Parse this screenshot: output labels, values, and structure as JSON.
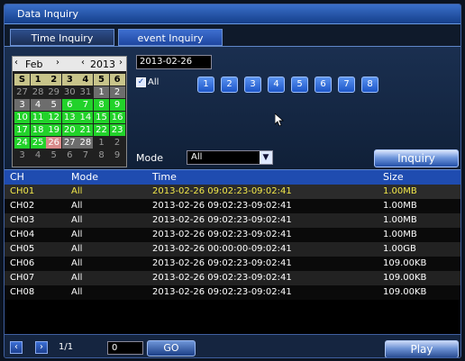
{
  "window": {
    "title": "Data Inquiry"
  },
  "tabs": [
    {
      "label": "Time Inquiry",
      "active": false
    },
    {
      "label": "event Inquiry",
      "active": true
    }
  ],
  "calendar": {
    "prev_month": "‹",
    "month": "Feb",
    "next_month": "›",
    "prev_year": "‹",
    "year": "2013",
    "next_year": "›",
    "weekdays": [
      "S",
      "1",
      "2",
      "3",
      "4",
      "5",
      "6"
    ],
    "weeks": [
      [
        "27",
        "28",
        "29",
        "30",
        "31",
        "1",
        "2"
      ],
      [
        "3",
        "4",
        "5",
        "6",
        "7",
        "8",
        "9"
      ],
      [
        "10",
        "11",
        "12",
        "13",
        "14",
        "15",
        "16"
      ],
      [
        "17",
        "18",
        "19",
        "20",
        "21",
        "22",
        "23"
      ],
      [
        "24",
        "25",
        "26",
        "27",
        "28",
        "1",
        "2"
      ],
      [
        "3",
        "4",
        "5",
        "6",
        "7",
        "8",
        "9"
      ]
    ]
  },
  "filter": {
    "date": "2013-02-26",
    "all_label": "All",
    "all_checked": true,
    "channels": [
      "1",
      "2",
      "3",
      "4",
      "5",
      "6",
      "7",
      "8"
    ],
    "mode_label": "Mode",
    "mode_value": "All",
    "inquiry_label": "Inquiry"
  },
  "table": {
    "headers": [
      "CH",
      "Mode",
      "Time",
      "Size"
    ],
    "rows": [
      {
        "ch": "CH01",
        "mode": "All",
        "time": "2013-02-26  09:02:23-09:02:41",
        "size": "1.00MB",
        "selected": true
      },
      {
        "ch": "CH02",
        "mode": "All",
        "time": "2013-02-26  09:02:23-09:02:41",
        "size": "1.00MB",
        "selected": false
      },
      {
        "ch": "CH03",
        "mode": "All",
        "time": "2013-02-26  09:02:23-09:02:41",
        "size": "1.00MB",
        "selected": false
      },
      {
        "ch": "CH04",
        "mode": "All",
        "time": "2013-02-26  09:02:23-09:02:41",
        "size": "1.00MB",
        "selected": false
      },
      {
        "ch": "CH05",
        "mode": "All",
        "time": "2013-02-26  00:00:00-09:02:41",
        "size": "1.00GB",
        "selected": false
      },
      {
        "ch": "CH06",
        "mode": "All",
        "time": "2013-02-26  09:02:23-09:02:41",
        "size": "109.00KB",
        "selected": false
      },
      {
        "ch": "CH07",
        "mode": "All",
        "time": "2013-02-26  09:02:23-09:02:41",
        "size": "109.00KB",
        "selected": false
      },
      {
        "ch": "CH08",
        "mode": "All",
        "time": "2013-02-26  09:02:23-09:02:41",
        "size": "109.00KB",
        "selected": false
      }
    ]
  },
  "bottom": {
    "prev_icon": "chevron-left-icon",
    "next_icon": "chevron-right-icon",
    "page": "1/1",
    "page_input": "0",
    "go_label": "GO",
    "play_label": "Play"
  },
  "colors": {
    "selected_text": "#f2e84a",
    "header_bg": "#1f4cb0",
    "calendar_green": "#22d22a",
    "calendar_tan": "#c8c48a",
    "calendar_gray": "#6d6d6d"
  }
}
